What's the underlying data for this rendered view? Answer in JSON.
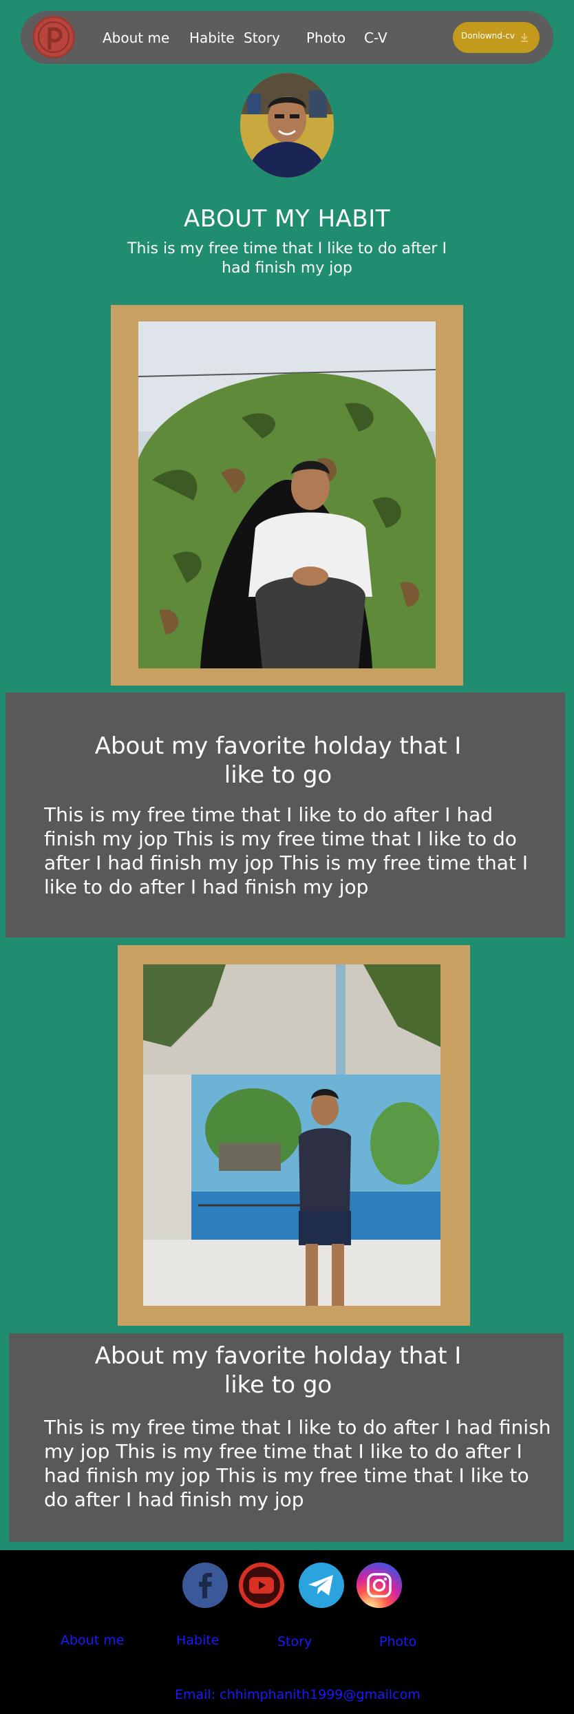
{
  "nav": {
    "items": [
      {
        "label": "About me"
      },
      {
        "label": "Habite"
      },
      {
        "label": "Story"
      },
      {
        "label": "Photo"
      },
      {
        "label": "C-V"
      }
    ],
    "download_label": "Donlownd-cv"
  },
  "habit": {
    "title": "ABOUT MY HABIT",
    "subtitle": "This is my free time that I like to do after I had finish my jop"
  },
  "sections": [
    {
      "title": "About my favorite holday that I like to go",
      "body": "This is my free time that I like to do after I had finish my jop This is my free time that I like to do after I had finish my jop This is my free time that I like to do after I had finish my jop"
    },
    {
      "title": "About my favorite holday that I like to go",
      "body": "This is my free time that I like to do after I had finish my jop This is my free time that I like to do after I had finish my jop This is my free time that I like to do after I had finish my jop"
    }
  ],
  "footer": {
    "social": [
      {
        "icon": "facebook-icon",
        "color": "#3b5998"
      },
      {
        "icon": "youtube-icon",
        "color": "#d93025"
      },
      {
        "icon": "telegram-icon",
        "color": "#2aa3de"
      },
      {
        "icon": "instagram-icon",
        "color": "#d6249f"
      }
    ],
    "links": [
      {
        "label": "About me"
      },
      {
        "label": "Habite"
      },
      {
        "label": "Story"
      },
      {
        "label": "Photo"
      }
    ],
    "email": "Email: chhimphanith1999@gmailcom"
  },
  "colors": {
    "background": "#208c70",
    "navbar": "#5d5d5d",
    "panel": "#595959",
    "frame": "#c8a062",
    "download_button": "#c39a1b",
    "footer": "#000000",
    "footer_link": "#1a1aff"
  }
}
